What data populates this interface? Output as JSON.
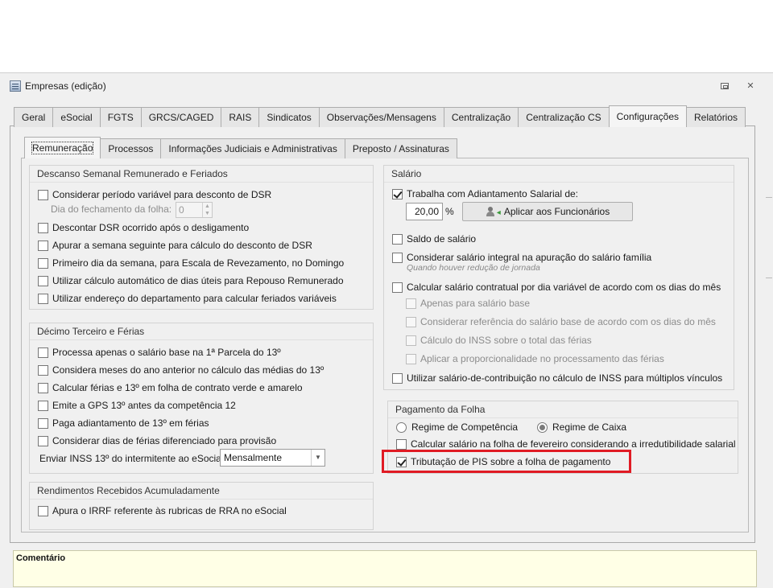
{
  "window": {
    "title": "Empresas (edição)"
  },
  "main_tabs": [
    "Geral",
    "eSocial",
    "FGTS",
    "GRCS/CAGED",
    "RAIS",
    "Sindicatos",
    "Observações/Mensagens",
    "Centralização",
    "Centralização CS",
    "Configurações",
    "Relatórios"
  ],
  "main_tab_active": "Configurações",
  "sub_tabs": [
    "Remuneração",
    "Processos",
    "Informações Judiciais e Administrativas",
    "Preposto / Assinaturas"
  ],
  "sub_tab_active": "Remuneração",
  "dsr": {
    "title": "Descanso Semanal Remunerado e Feriados",
    "opt1": "Considerar período variável para desconto de DSR",
    "dia_label": "Dia do fechamento da folha:",
    "dia_value": "0",
    "opt2": "Descontar DSR ocorrido após o desligamento",
    "opt3": "Apurar a semana seguinte para cálculo do desconto de DSR",
    "opt4": "Primeiro dia da semana, para Escala de Revezamento, no Domingo",
    "opt5": "Utilizar cálculo automático de dias úteis para Repouso Remunerado",
    "opt6": "Utilizar endereço do departamento para calcular feriados variáveis"
  },
  "decimo": {
    "title": "Décimo Terceiro e Férias",
    "opt1": "Processa apenas o salário base na 1ª Parcela do 13º",
    "opt2": "Considera meses do ano anterior no cálculo das médias do 13º",
    "opt3": "Calcular férias e 13º em folha de contrato verde e amarelo",
    "opt4": "Emite a GPS 13º antes da competência 12",
    "opt5": "Paga adiantamento de 13º em férias",
    "opt6": "Considerar dias de férias diferenciado para provisão",
    "inss_label": "Enviar INSS 13º do intermitente ao eSocial",
    "inss_value": "Mensalmente"
  },
  "rra": {
    "title": "Rendimentos Recebidos Acumuladamente",
    "opt1": "Apura o IRRF referente às rubricas de RRA no eSocial"
  },
  "salario": {
    "title": "Salário",
    "adiantamento": "Trabalha com Adiantamento Salarial de:",
    "percent_value": "20,00",
    "percent_symbol": "%",
    "apply_button": "Aplicar aos Funcionários",
    "saldo": "Saldo de salário",
    "integral": "Considerar salário integral na apuração do salário família",
    "integral_hint": "Quando houver redução de jornada",
    "contratual": "Calcular salário contratual por dia variável de acordo com os dias do mês",
    "sub1": "Apenas para salário base",
    "sub2": "Considerar referência do salário base de acordo com os dias do mês",
    "sub3": "Cálculo do INSS sobre o total das férias",
    "sub4": "Aplicar a proporcionalidade no processamento das férias",
    "contribuicao": "Utilizar salário-de-contribuição no cálculo de INSS para múltiplos vínculos"
  },
  "pagamento": {
    "title": "Pagamento da Folha",
    "regime_competencia": "Regime de Competência",
    "regime_caixa": "Regime de Caixa",
    "fevereiro": "Calcular salário na folha de fevereiro considerando a irredutibilidade salarial",
    "pis": "Tributação de PIS sobre a folha de pagamento"
  },
  "comentario": {
    "label": "Comentário"
  },
  "colors": {
    "highlight": "#e01b24",
    "comment_bg": "#ffffe6"
  }
}
